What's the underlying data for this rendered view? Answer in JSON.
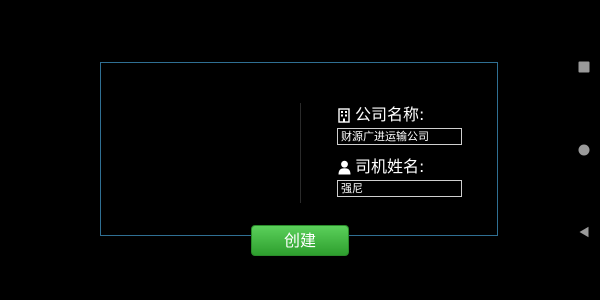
{
  "form": {
    "company_label": "公司名称:",
    "company_value": "财源广进运输公司",
    "driver_label": "司机姓名:",
    "driver_value": "强尼",
    "create_label": "创建"
  },
  "icons": {
    "company": "building-icon",
    "driver": "person-icon",
    "nav_recent": "square-icon",
    "nav_home": "circle-icon",
    "nav_back": "triangle-back-icon"
  },
  "colors": {
    "background": "#000000",
    "panel_border": "#2f6f93",
    "button_green": "#3fb83f",
    "text": "#ffffff"
  }
}
